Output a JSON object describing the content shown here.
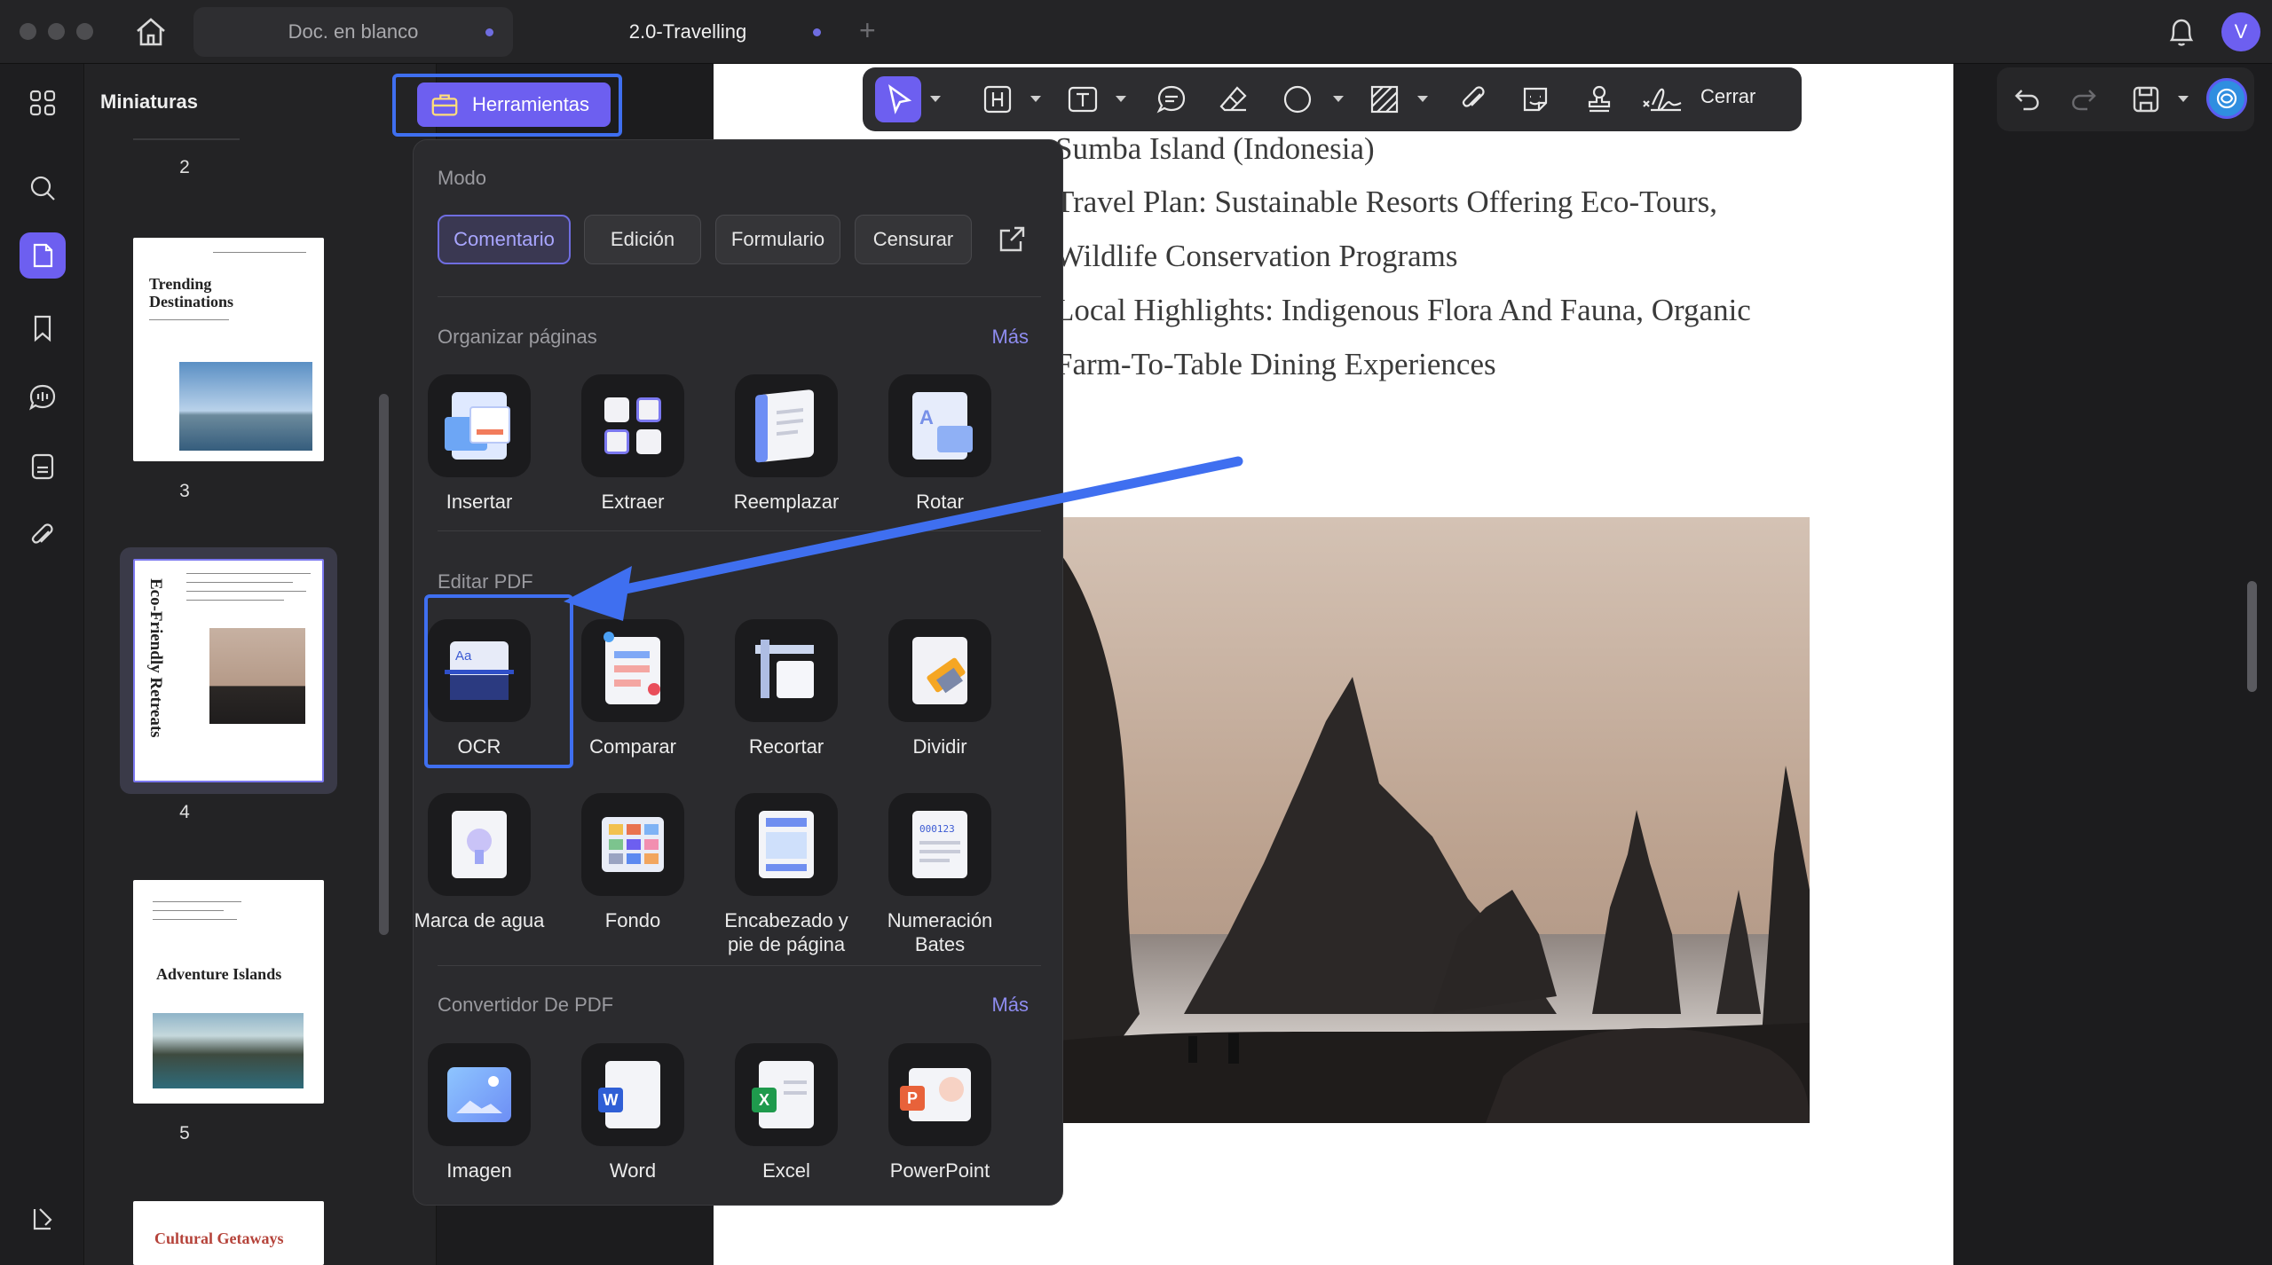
{
  "titlebar": {
    "tabs": [
      {
        "label": "Doc. en blanco"
      },
      {
        "label": "2.0-Travelling"
      }
    ],
    "avatar_letter": "V"
  },
  "thumbnails": {
    "title": "Miniaturas",
    "page_numbers": [
      "2",
      "3",
      "4",
      "5"
    ],
    "page3_title": "Trending Destinations",
    "page4_title": "Eco-Friendly Retreats",
    "page5_title": "Adventure Islands",
    "page6_title": "Cultural Getaways"
  },
  "tools_button": {
    "label": "Herramientas"
  },
  "toolbar": {
    "close_label": "Cerrar"
  },
  "popover": {
    "mode_label": "Modo",
    "modes": [
      {
        "label": "Comentario",
        "active": true
      },
      {
        "label": "Edición",
        "active": false
      },
      {
        "label": "Formulario",
        "active": false
      },
      {
        "label": "Censurar",
        "active": false
      }
    ],
    "organize": {
      "title": "Organizar páginas",
      "more": "Más",
      "tools": [
        "Insertar",
        "Extraer",
        "Reemplazar",
        "Rotar"
      ]
    },
    "edit": {
      "title": "Editar PDF",
      "tools": [
        "OCR",
        "Comparar",
        "Recortar",
        "Dividir",
        "Marca de agua",
        "Fondo",
        "Encabezado y pie de página",
        "Numeración Bates"
      ]
    },
    "convert": {
      "title": "Convertidor De PDF",
      "more": "Más",
      "tools": [
        "Imagen",
        "Word",
        "Excel",
        "PowerPoint"
      ]
    }
  },
  "document": {
    "lines": [
      "Sumba Island (Indonesia)",
      "Travel Plan: Sustainable Resorts Offering Eco-Tours,",
      "Wildlife Conservation Programs",
      "Local Highlights: Indigenous Flora And Fauna, Organic",
      "Farm-To-Table Dining Experiences"
    ]
  },
  "colors": {
    "accent": "#6f6de0",
    "highlight": "#3f6ff0",
    "link": "#8e8cf0"
  }
}
